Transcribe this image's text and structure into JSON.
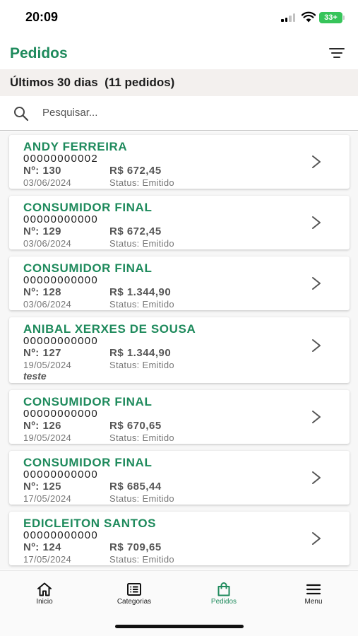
{
  "status_bar": {
    "time": "20:09",
    "battery": "33+",
    "icons": [
      "cellular-signal-icon",
      "wifi-icon",
      "battery-icon"
    ]
  },
  "header": {
    "title": "Pedidos",
    "filter_icon": "filter-icon"
  },
  "summary": {
    "text": "Últimos 30 dias  (11 pedidos)"
  },
  "search": {
    "placeholder": "Pesquisar...",
    "value": ""
  },
  "orders": [
    {
      "name": "ANDY FERREIRA",
      "document": "00000000002",
      "number": "Nº: 130",
      "total": "R$ 672,45",
      "date": "03/06/2024",
      "status": "Status: Emitido",
      "note": ""
    },
    {
      "name": "CONSUMIDOR FINAL",
      "document": "00000000000",
      "number": "Nº: 129",
      "total": "R$ 672,45",
      "date": "03/06/2024",
      "status": "Status: Emitido",
      "note": ""
    },
    {
      "name": "CONSUMIDOR FINAL",
      "document": "00000000000",
      "number": "Nº: 128",
      "total": "R$ 1.344,90",
      "date": "03/06/2024",
      "status": "Status: Emitido",
      "note": ""
    },
    {
      "name": "ANIBAL XERXES DE SOUSA",
      "document": "00000000000",
      "number": "Nº: 127",
      "total": "R$ 1.344,90",
      "date": "19/05/2024",
      "status": "Status: Emitido",
      "note": "teste"
    },
    {
      "name": "CONSUMIDOR FINAL",
      "document": "00000000000",
      "number": "Nº: 126",
      "total": "R$ 670,65",
      "date": "19/05/2024",
      "status": "Status: Emitido",
      "note": ""
    },
    {
      "name": "CONSUMIDOR FINAL",
      "document": "00000000000",
      "number": "Nº: 125",
      "total": "R$ 685,44",
      "date": "17/05/2024",
      "status": "Status: Emitido",
      "note": ""
    },
    {
      "name": "EDICLEITON SANTOS",
      "document": "00000000000",
      "number": "Nº: 124",
      "total": "R$ 709,65",
      "date": "17/05/2024",
      "status": "Status: Emitido",
      "note": ""
    }
  ],
  "tabbar": {
    "active": "pedidos",
    "tabs": [
      {
        "label": "Inicio",
        "icon": "home-icon"
      },
      {
        "label": "Categorias",
        "icon": "list-icon"
      },
      {
        "label": "Pedidos",
        "icon": "shopping-bag-icon"
      },
      {
        "label": "Menu",
        "icon": "menu-icon"
      }
    ]
  },
  "colors": {
    "accent": "#1e8a5c",
    "summary_background": "#f3f0ee",
    "battery": "#37c45a",
    "muted_text": "#777777"
  }
}
